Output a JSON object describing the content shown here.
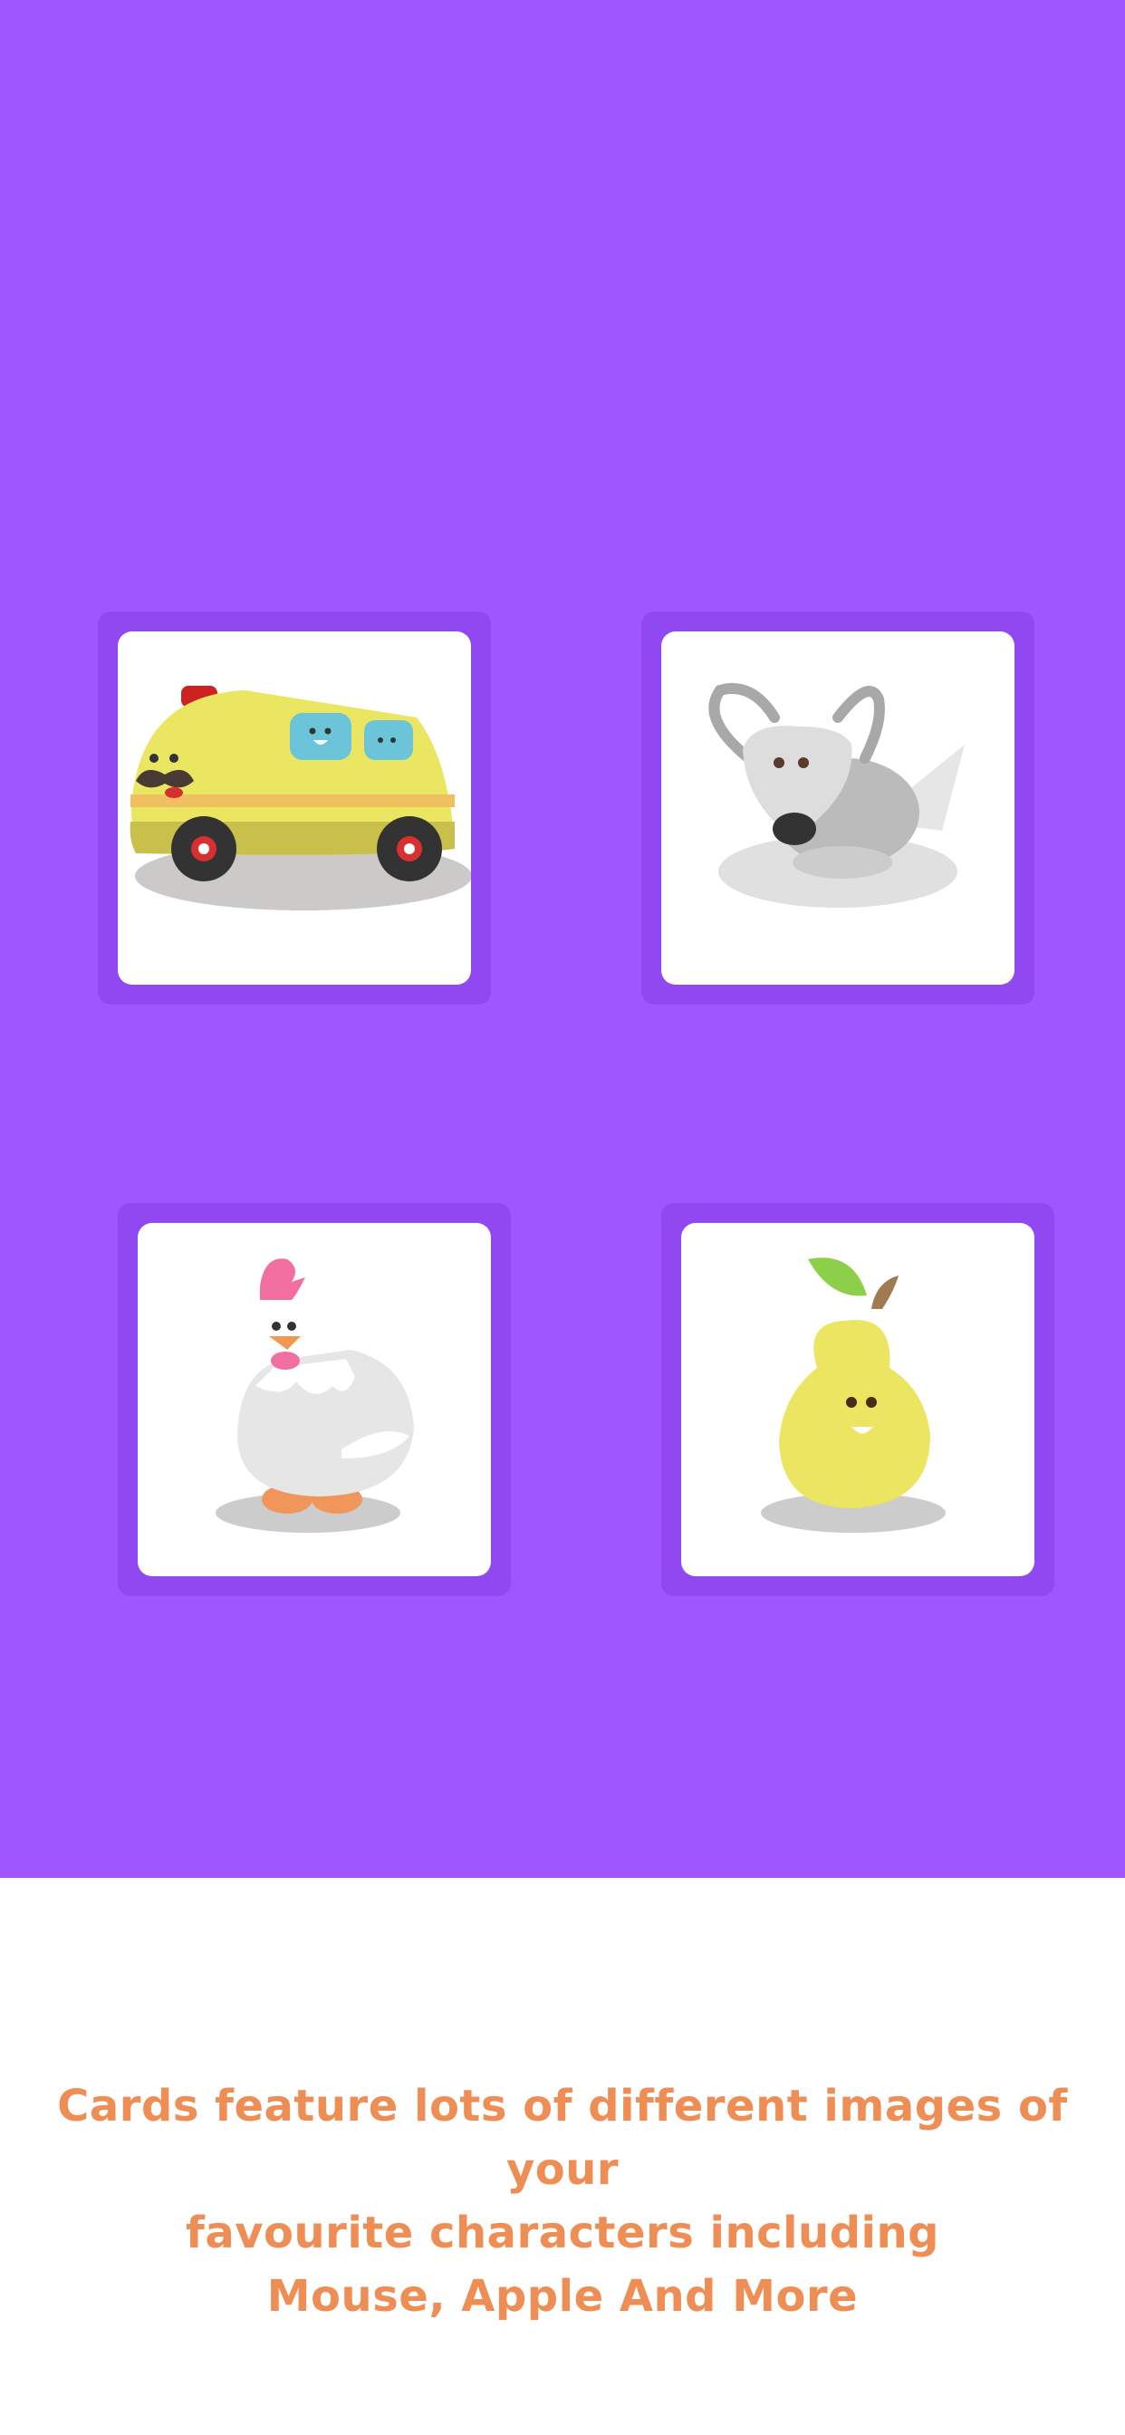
{
  "colors": {
    "stage_background": "#a056fe",
    "card_frame": "#9049f0",
    "card_face": "#ffffff",
    "caption_text": "#ee8e55",
    "page_background": "#ffffff"
  },
  "cards": [
    {
      "character": "school-bus",
      "icon": "bus-icon"
    },
    {
      "character": "dog",
      "icon": "dog-icon"
    },
    {
      "character": "hen",
      "icon": "hen-icon"
    },
    {
      "character": "pear",
      "icon": "pear-icon"
    }
  ],
  "caption": {
    "line1": "Cards feature lots of different images of your",
    "line2": "favourite characters including",
    "line3": "Mouse, Apple And More"
  }
}
